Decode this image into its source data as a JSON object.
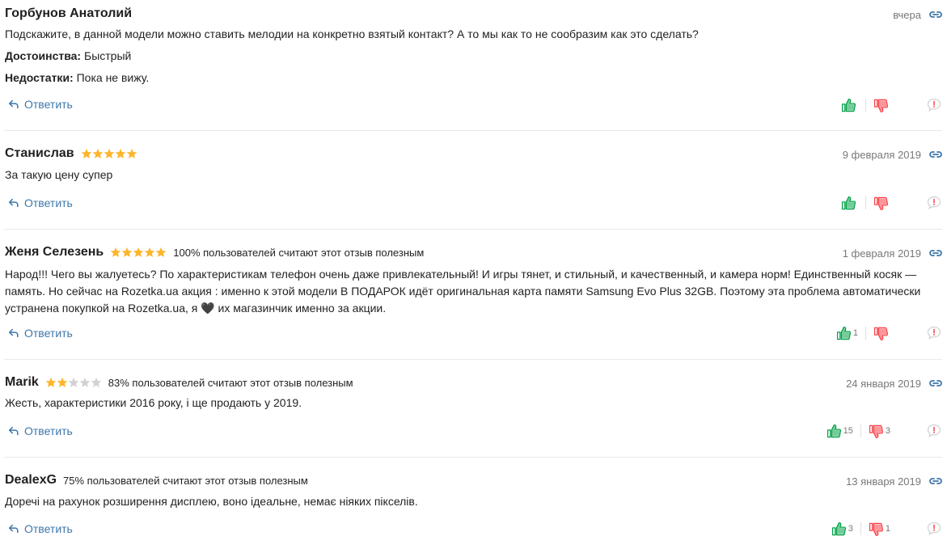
{
  "colors": {
    "link": "#3e77aa",
    "star": "#fdb52b",
    "star_empty": "#d2d2d2",
    "like": "#00a046",
    "dislike": "#f84147",
    "muted": "#797878"
  },
  "reply_label": "Ответить",
  "reviews": [
    {
      "author": "Горбунов Анатолий",
      "rating": null,
      "useful": "",
      "date": "вчера",
      "text": "Подскажите, в данной модели можно ставить мелодии на конкретно взятый контакт? А то мы как то не сообразим как это сделать?",
      "pros_label": "Достоинства:",
      "pros": "Быстрый",
      "cons_label": "Недостатки:",
      "cons": "Пока не вижу.",
      "likes": "",
      "dislikes": ""
    },
    {
      "author": "Станислав",
      "rating": 5,
      "useful": "",
      "date": "9 февраля 2019",
      "text": "За такую цену супер",
      "likes": "",
      "dislikes": ""
    },
    {
      "author": "Женя Селезень",
      "rating": 5,
      "useful": "100% пользователей считают этот отзыв полезным",
      "date": "1 февраля 2019",
      "text": "Народ!!! Чего вы жалуетесь? По характеристикам телефон очень даже привлекательный! И игры тянет, и стильный, и качественный, и камера норм! Единственный косяк — память. Но сейчас на Rozetka.ua акция : именно к этой модели В ПОДАРОК идёт оригинальная карта памяти Samsung Evo Plus 32GB. Поэтому эта проблема автоматически устранена покупкой на Rozetka.ua, я 🖤 их магазинчик именно за акции.",
      "likes": "1",
      "dislikes": ""
    },
    {
      "author": "Marik",
      "rating": 2,
      "useful": "83% пользователей считают этот отзыв полезным",
      "date": "24 января 2019",
      "text": "Жесть, характеристики 2016 року, і ще продають у 2019.",
      "likes": "15",
      "dislikes": "3"
    },
    {
      "author": "DealexG",
      "rating": null,
      "useful": "75% пользователей считают этот отзыв полезным",
      "date": "13 января 2019",
      "text": "Доречі на рахунок розширення дисплею, воно ідеальне, немає ніяких пікселів.",
      "likes": "3",
      "dislikes": "1"
    }
  ]
}
